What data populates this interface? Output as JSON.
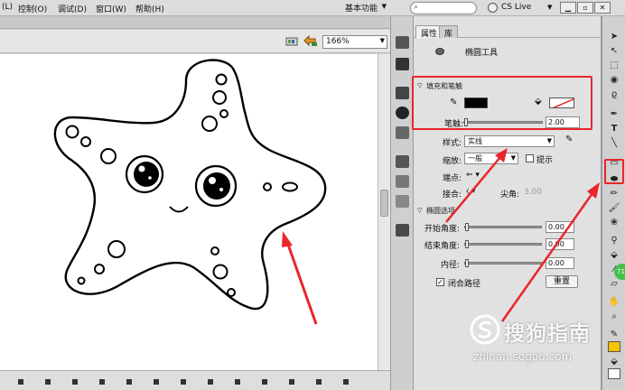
{
  "menubar": {
    "items": [
      "(L)",
      "控制(O)",
      "调试(D)",
      "窗口(W)",
      "帮助(H)"
    ],
    "workspace": "基本功能",
    "search_placeholder": "",
    "cs_live": "CS Live"
  },
  "stage": {
    "zoom": "166%"
  },
  "properties": {
    "tabs": [
      "属性",
      "库"
    ],
    "tool_name": "椭圆工具",
    "fill_stroke": {
      "header": "填充和笔触",
      "stroke_label": "笔触:",
      "stroke_value": "2.00",
      "stroke_color": "#000000",
      "style_label": "样式:",
      "style_value": "实线",
      "scale_label": "缩放:",
      "scale_value": "一般",
      "hint_label": "提示",
      "cap_label": "端点:",
      "join_label": "接合:",
      "miter_label": "尖角:",
      "miter_value": "3.00"
    },
    "ellipse_options": {
      "header": "椭圆选项",
      "start_angle_label": "开始角度:",
      "start_angle_value": "0.00",
      "end_angle_label": "结束角度:",
      "end_angle_value": "0.00",
      "inner_radius_label": "内径:",
      "inner_radius_value": "0.00",
      "close_path_label": "闭合路径",
      "reset_label": "重置"
    }
  },
  "watermark": {
    "text": "搜狗指南",
    "url": "zhinan.sogou.com"
  },
  "badge": "71",
  "colors": {
    "accent_red": "#e8262b",
    "panel_bg": "#e1e1e1",
    "stage_bg": "#ffffff",
    "swatch_yellow": "#f5c400"
  }
}
